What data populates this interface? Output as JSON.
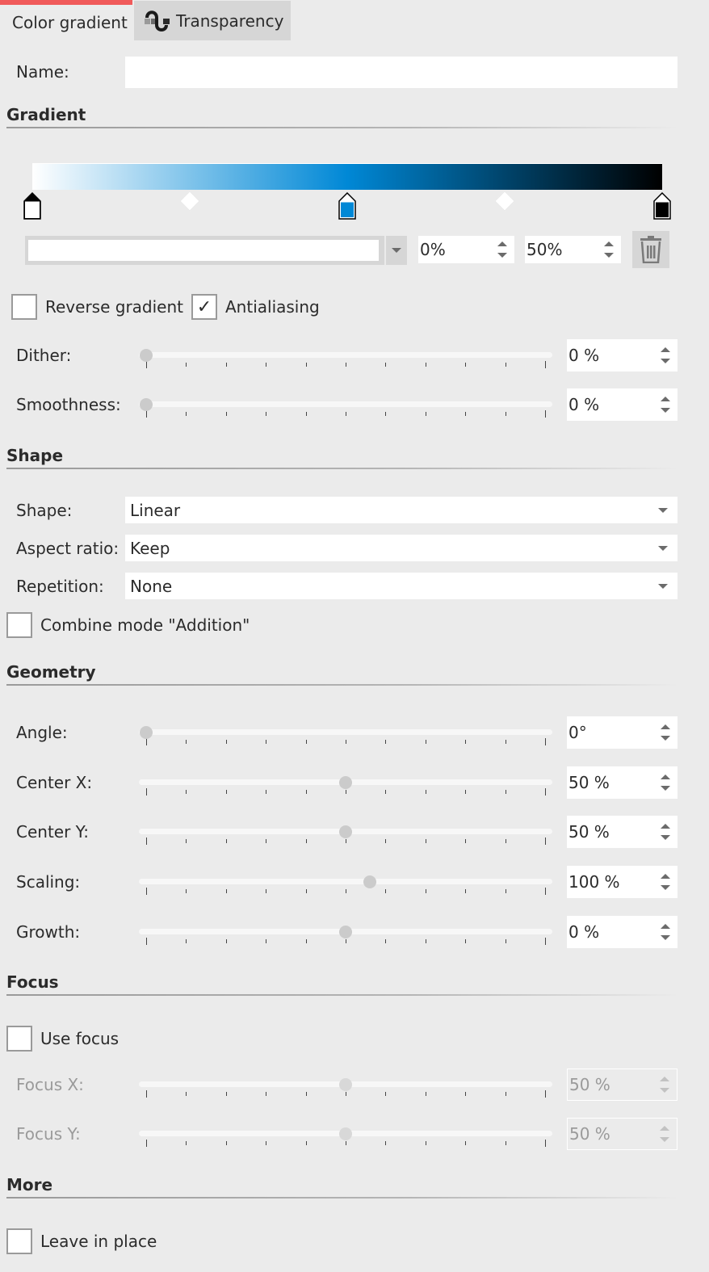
{
  "tabs": [
    {
      "label": "Color gradient",
      "active": true,
      "icon": null
    },
    {
      "label": "Transparency",
      "active": false,
      "icon": "transparency-icon"
    }
  ],
  "colors": {
    "accent_tab": "#f05a5a",
    "gradient_start": "#ffffff",
    "gradient_mid": "#0088d6",
    "gradient_end": "#000000"
  },
  "name_field": {
    "label": "Name:",
    "value": ""
  },
  "sections": {
    "gradient": "Gradient",
    "shape": "Shape",
    "geometry": "Geometry",
    "focus": "Focus",
    "more": "More"
  },
  "gradient": {
    "stops": [
      {
        "position": 0,
        "color": "#ffffff",
        "selected": true
      },
      {
        "position": 50,
        "color": "#0088d6",
        "selected": false
      },
      {
        "position": 100,
        "color": "#000000",
        "selected": false
      }
    ],
    "midpoints": [
      25,
      75
    ],
    "selected_color_value": "",
    "stop_position": "0%",
    "stop_midpoint": "50%",
    "delete_icon": "trash-icon"
  },
  "options": {
    "reverse_gradient": {
      "label": "Reverse gradient",
      "checked": false
    },
    "antialiasing": {
      "label": "Antialiasing",
      "checked": true,
      "check_glyph": "✓"
    }
  },
  "gradient_sliders": [
    {
      "label": "Dither:",
      "value_text": "0 %",
      "fraction": 0.0
    },
    {
      "label": "Smoothness:",
      "value_text": "0 %",
      "fraction": 0.0
    }
  ],
  "shape": {
    "shape": {
      "label": "Shape:",
      "value": "Linear"
    },
    "aspect_ratio": {
      "label": "Aspect ratio:",
      "value": "Keep"
    },
    "repetition": {
      "label": "Repetition:",
      "value": "None"
    },
    "combine_mode": {
      "label": "Combine mode \"Addition\"",
      "checked": false
    }
  },
  "geometry_sliders": [
    {
      "label": "Angle:",
      "value_text": "0°",
      "fraction": 0.0
    },
    {
      "label": "Center X:",
      "value_text": "50 %",
      "fraction": 0.5
    },
    {
      "label": "Center Y:",
      "value_text": "50 %",
      "fraction": 0.5
    },
    {
      "label": "Scaling:",
      "value_text": "100 %",
      "fraction": 0.56
    },
    {
      "label": "Growth:",
      "value_text": "0 %",
      "fraction": 0.5
    }
  ],
  "focus": {
    "use_focus": {
      "label": "Use focus",
      "checked": false
    },
    "sliders": [
      {
        "label": "Focus X:",
        "value_text": "50 %",
        "fraction": 0.5,
        "disabled": true
      },
      {
        "label": "Focus Y:",
        "value_text": "50 %",
        "fraction": 0.5,
        "disabled": true
      }
    ]
  },
  "more": {
    "leave_in_place": {
      "label": "Leave in place",
      "checked": false
    }
  }
}
